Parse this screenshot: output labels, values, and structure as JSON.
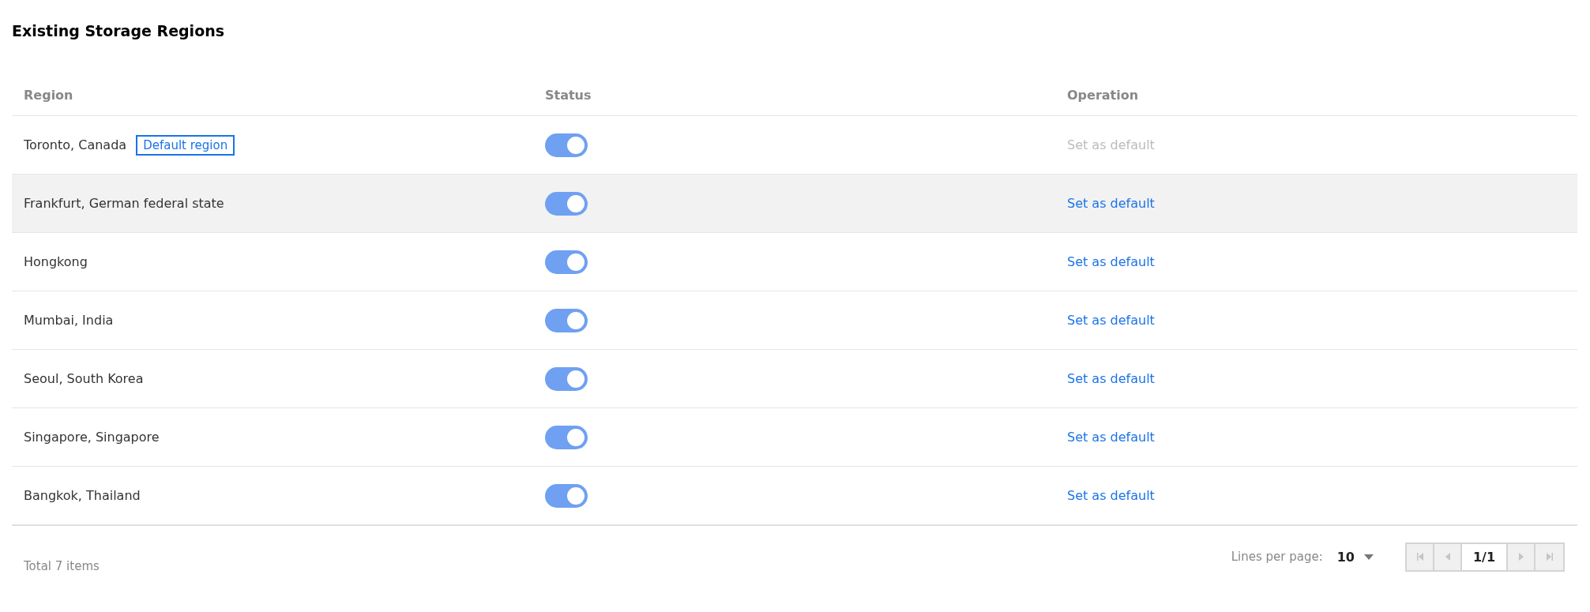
{
  "title": "Existing Storage Regions",
  "table": {
    "columns": [
      "Region",
      "Status",
      "Operation"
    ],
    "rows": [
      {
        "region": "Toronto, Canada",
        "tag": "Default region",
        "enabled": true,
        "action": "Set as default",
        "disabled": true,
        "highlighted": false
      },
      {
        "region": "Frankfurt, German federal state",
        "enabled": true,
        "action": "Set as default",
        "disabled": false,
        "highlighted": true
      },
      {
        "region": "Hongkong",
        "enabled": true,
        "action": "Set as default",
        "disabled": false,
        "highlighted": false
      },
      {
        "region": "Mumbai, India",
        "enabled": true,
        "action": "Set as default",
        "disabled": false,
        "highlighted": false
      },
      {
        "region": "Seoul, South Korea",
        "enabled": true,
        "action": "Set as default",
        "disabled": false,
        "highlighted": false
      },
      {
        "region": "Singapore, Singapore",
        "enabled": true,
        "action": "Set as default",
        "disabled": false,
        "highlighted": false
      },
      {
        "region": "Bangkok, Thailand",
        "enabled": true,
        "action": "Set as default",
        "disabled": false,
        "highlighted": false
      }
    ]
  },
  "footer": {
    "total": "Total 7 items",
    "lines_label": "Lines per page:",
    "lines_value": "10",
    "page": "1/1",
    "nav": [
      {
        "kind": "first",
        "disabled": true
      },
      {
        "kind": "prev",
        "disabled": true
      },
      {
        "kind": "page"
      },
      {
        "kind": "next",
        "disabled": true
      },
      {
        "kind": "last",
        "disabled": true
      }
    ]
  }
}
